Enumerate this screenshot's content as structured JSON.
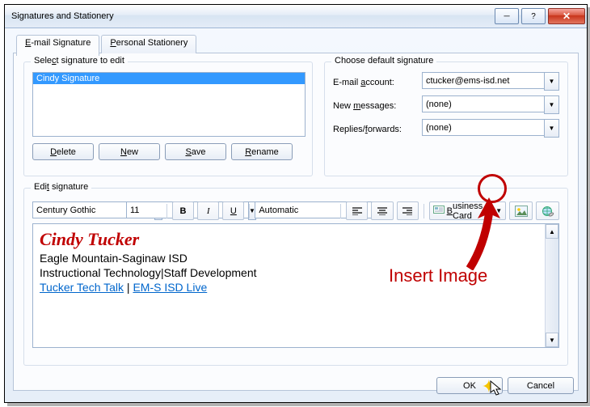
{
  "window": {
    "title": "Signatures and Stationery"
  },
  "tabs": {
    "email": "E-mail Signature",
    "stationery": "Personal Stationery"
  },
  "select_group": {
    "title": "Select signature to edit",
    "item": "Cindy Signature",
    "delete": "Delete",
    "new": "New",
    "save": "Save",
    "rename": "Rename"
  },
  "default_group": {
    "title": "Choose default signature",
    "account_lbl": "E-mail account:",
    "account_val": "ctucker@ems-isd.net",
    "newmsg_lbl": "New messages:",
    "newmsg_val": "(none)",
    "reply_lbl": "Replies/forwards:",
    "reply_val": "(none)"
  },
  "edit_group": {
    "title": "Edit signature",
    "font": "Century Gothic",
    "size": "11",
    "color": "Automatic",
    "bizcard": "Business Card"
  },
  "signature": {
    "name": "Cindy Tucker",
    "line1": "Eagle Mountain-Saginaw ISD",
    "line2": "Instructional Technology|Staff Development",
    "link1": "Tucker Tech Talk",
    "sep": " | ",
    "link2": "EM-S ISD Live"
  },
  "footer": {
    "ok": "OK",
    "cancel": "Cancel"
  },
  "annotation": {
    "text": "Insert Image"
  }
}
